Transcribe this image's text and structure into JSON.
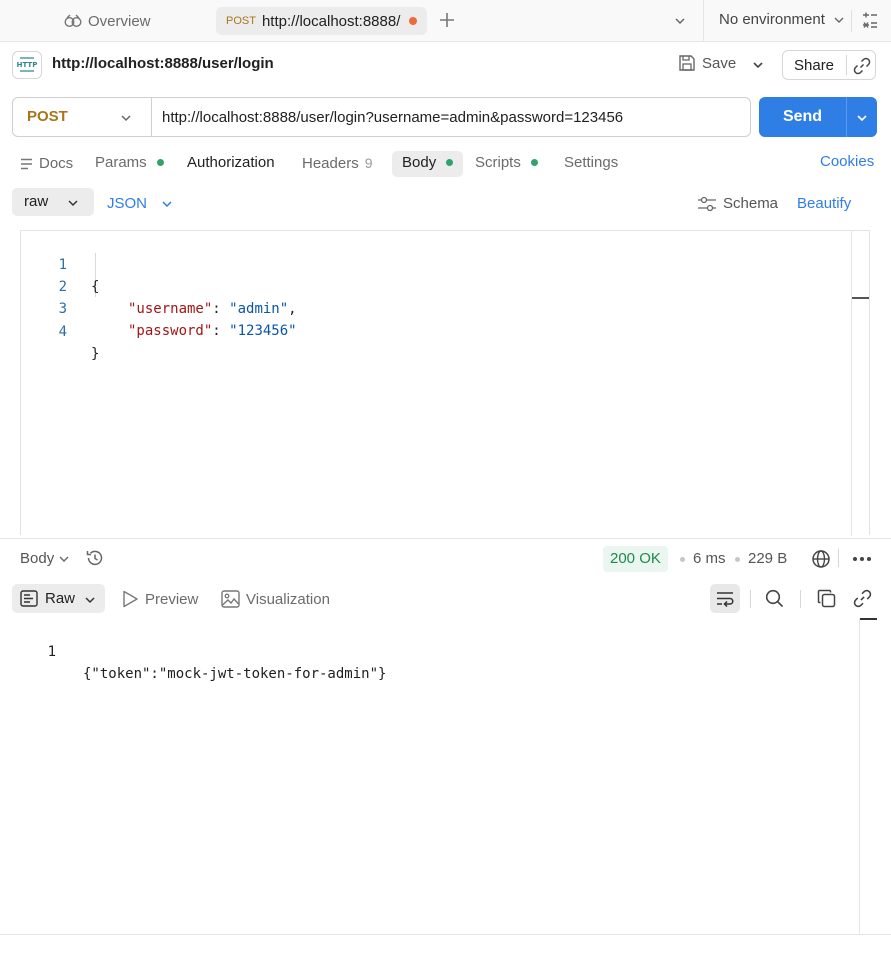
{
  "tabs": {
    "overview_label": "Overview",
    "active_method": "POST",
    "active_url": "http://localhost:8888/",
    "environment": "No environment"
  },
  "request": {
    "title": "http://localhost:8888/user/login",
    "save_label": "Save",
    "share_label": "Share",
    "method": "POST",
    "url": "http://localhost:8888/user/login?username=admin&password=123456",
    "send_label": "Send"
  },
  "request_tabs": [
    {
      "label": "Docs"
    },
    {
      "label": "Params"
    },
    {
      "label": "Authorization"
    },
    {
      "label": "Headers",
      "count": "9"
    },
    {
      "label": "Body"
    },
    {
      "label": "Scripts"
    },
    {
      "label": "Settings"
    }
  ],
  "cookies_label": "Cookies",
  "body_options": {
    "mode": "raw",
    "language": "JSON",
    "schema_label": "Schema",
    "beautify_label": "Beautify"
  },
  "editor": {
    "lines": [
      {
        "num": "1",
        "open": "{"
      },
      {
        "num": "2",
        "key": "\"username\"",
        "colon": ": ",
        "value": "\"admin\"",
        "tail": ","
      },
      {
        "num": "3",
        "key": "\"password\"",
        "colon": ": ",
        "value": "\"123456\"",
        "tail": ""
      },
      {
        "num": "4",
        "close": "}"
      }
    ]
  },
  "response": {
    "body_label": "Body",
    "status": "200 OK",
    "time": "6 ms",
    "size": "229 B",
    "view_mode": "Raw",
    "preview_label": "Preview",
    "visualization_label": "Visualization",
    "line_number": "1",
    "content": "{\"token\":\"mock-jwt-token-for-admin\"}"
  },
  "colors": {
    "accent": "#2f7ee6",
    "post_method": "#a8761a",
    "status_ok": "#1f8a4c",
    "unsaved_dot": "#ef6a3a",
    "active_dot": "#2fa36b"
  },
  "icons": [
    "overview-icon",
    "plus-icon",
    "chevron-down-icon",
    "calculator-icon",
    "http-icon",
    "save-icon",
    "link-icon",
    "docs-icon",
    "schema-icon",
    "history-icon",
    "globe-icon",
    "more-icon",
    "raw-view-icon",
    "play-icon",
    "image-icon",
    "wrap-icon",
    "search-icon",
    "copy-icon"
  ]
}
